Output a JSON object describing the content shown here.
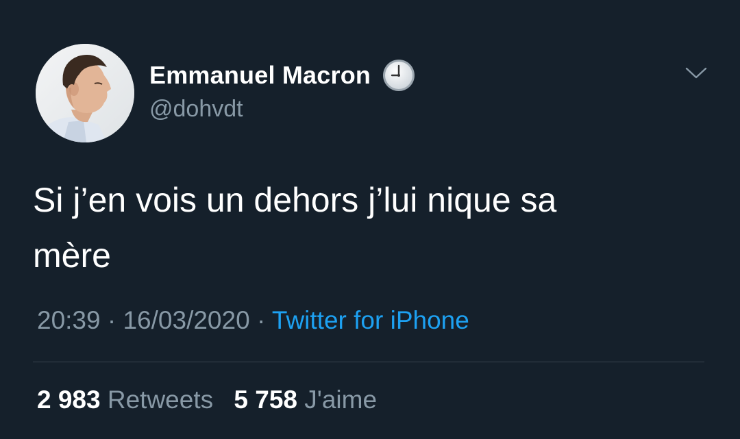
{
  "tweet": {
    "author": {
      "display_name": "Emmanuel Macron",
      "handle": "@dohvdt",
      "badge_icon": "clock-emoji-icon",
      "avatar": "avatar-photo"
    },
    "text_line_1": "Si j’en vois un dehors j’lui nique sa",
    "text_line_2": "mère",
    "time": "20:39",
    "separator": "·",
    "date": "16/03/2020",
    "source": "Twitter for iPhone",
    "stats": {
      "retweets_count": "2 983",
      "retweets_label": "Retweets",
      "likes_count": "5 758",
      "likes_label": "J'aime"
    },
    "menu_icon": "chevron-down-icon"
  },
  "colors": {
    "background": "#15202b",
    "primary_text": "#ffffff",
    "secondary_text": "#8899a6",
    "link": "#1da1f2",
    "divider": "#38444d"
  }
}
